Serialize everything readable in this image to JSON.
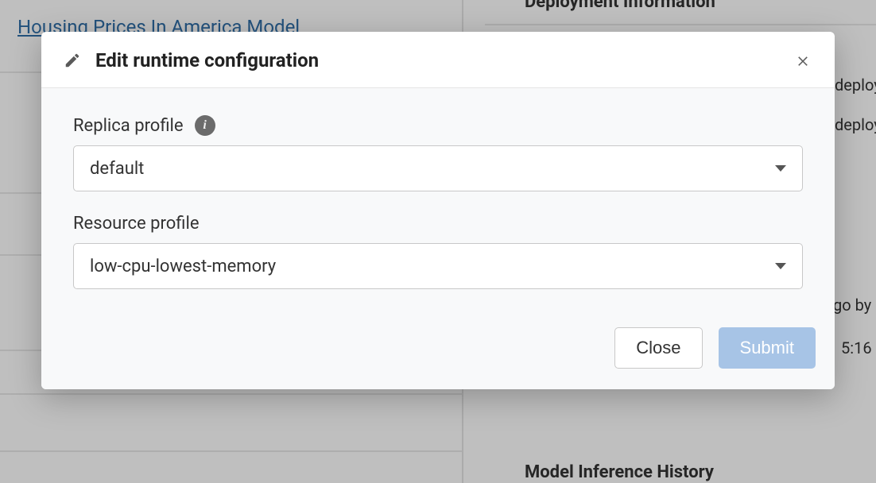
{
  "background": {
    "model_link": "Housing Prices In America Model",
    "deploy_heading": "Deployment Information",
    "history_heading": "Model Inference History",
    "right_snippets": {
      "deploy1": "deployn",
      "deploy2": "deploym",
      "go_by": "go by",
      "time": "5:16"
    }
  },
  "modal": {
    "title": "Edit runtime configuration",
    "replica_label": "Replica profile",
    "replica_value": "default",
    "resource_label": "Resource profile",
    "resource_value": "low-cpu-lowest-memory",
    "close_label": "Close",
    "submit_label": "Submit"
  }
}
